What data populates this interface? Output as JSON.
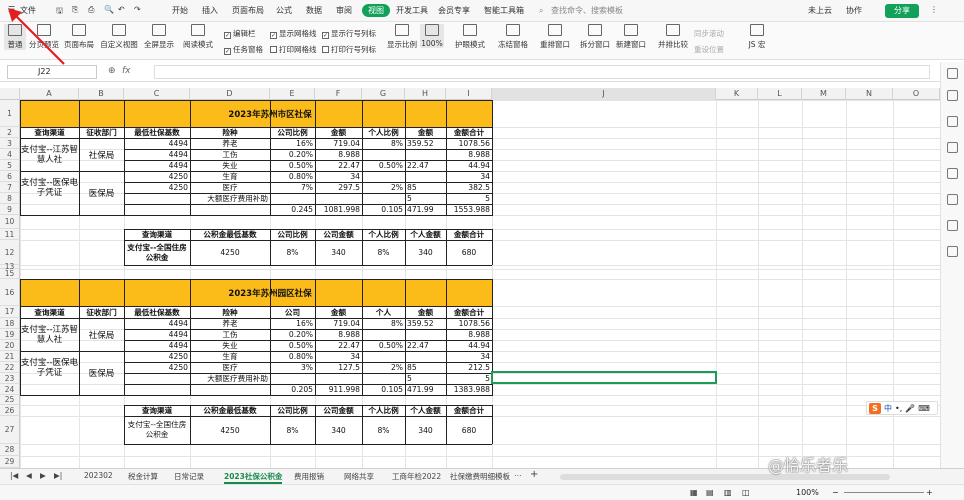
{
  "topbar": {
    "menu": "文件",
    "tabs": [
      "开始",
      "插入",
      "页面布局",
      "公式",
      "数据",
      "审阅",
      "视图",
      "开发工具",
      "会员专享",
      "智能工具箱"
    ],
    "active_tab": "视图",
    "search_placeholder": "查找命令、搜索模板",
    "cloud": "未上云",
    "collab": "协作",
    "share": "分享"
  },
  "ribbon": {
    "buttons": [
      "普通",
      "分页预览",
      "页面布局",
      "自定义视图",
      "全屏显示",
      "阅读模式",
      "显示比例",
      "100%",
      "护眼模式",
      "冻结窗格",
      "重排窗口",
      "拆分窗口",
      "新建窗口",
      "并排比较",
      "JS 宏"
    ],
    "checks": [
      {
        "label": "编辑栏",
        "checked": true
      },
      {
        "label": "显示网格线",
        "checked": true
      },
      {
        "label": "显示行号列标",
        "checked": true
      },
      {
        "label": "任务窗格",
        "checked": true
      },
      {
        "label": "打印网格线",
        "checked": false
      },
      {
        "label": "打印行号列标",
        "checked": false
      }
    ],
    "disabled": [
      "同步滚动",
      "重设位置"
    ]
  },
  "formula_bar": {
    "cell_ref": "J22",
    "fx": "fx",
    "value": ""
  },
  "columns": [
    "A",
    "B",
    "C",
    "D",
    "E",
    "F",
    "G",
    "H",
    "I",
    "J",
    "K",
    "L",
    "M",
    "N",
    "O"
  ],
  "rows": [
    "1",
    "2",
    "3",
    "4",
    "5",
    "6",
    "7",
    "8",
    "9",
    "10",
    "11",
    "12",
    "13",
    "15",
    "16",
    "17",
    "18",
    "19",
    "20",
    "21",
    "22",
    "23",
    "24",
    "25",
    "26",
    "27",
    "28",
    "29"
  ],
  "table1": {
    "title": "2023年苏州市区社保",
    "headers": [
      "查询渠道",
      "征收部门",
      "最低社保基数",
      "险种",
      "公司比例",
      "金额",
      "个人比例",
      "金额",
      "金额合计"
    ],
    "channel1": "支付宝--江苏智慧人社",
    "dept1": "社保局",
    "channel2": "支付宝--医保电子凭证",
    "dept2": "医保局",
    "rows": [
      [
        "4494",
        "养老",
        "16%",
        "719.04",
        "8%",
        "359.52",
        "1078.56"
      ],
      [
        "4494",
        "工伤",
        "0.20%",
        "8.988",
        "",
        "",
        "8.988"
      ],
      [
        "4494",
        "失业",
        "0.50%",
        "22.47",
        "0.50%",
        "22.47",
        "44.94"
      ],
      [
        "4250",
        "生育",
        "0.80%",
        "34",
        "",
        "",
        "34"
      ],
      [
        "4250",
        "医疗",
        "7%",
        "297.5",
        "2%",
        "85",
        "382.5"
      ],
      [
        "",
        "大额医疗费用补助",
        "",
        "",
        "",
        "5",
        "5"
      ],
      [
        "",
        "",
        "0.245",
        "1081.998",
        "0.105",
        "471.99",
        "1553.988"
      ]
    ],
    "fund_headers": [
      "查询渠道",
      "公积金最低基数",
      "公司比例",
      "公司金额",
      "个人比例",
      "个人金额",
      "金额合计"
    ],
    "fund_row": [
      "支付宝--全国住房公积金",
      "4250",
      "8%",
      "340",
      "8%",
      "340",
      "680"
    ]
  },
  "table2": {
    "title": "2023年苏州园区社保",
    "headers": [
      "查询渠道",
      "征收部门",
      "最低社保基数",
      "险种",
      "公司",
      "金额",
      "个人",
      "金额",
      "金额合计"
    ],
    "channel1": "支付宝--江苏智慧人社",
    "dept1": "社保局",
    "channel2": "支付宝--医保电子凭证",
    "dept2": "医保局",
    "rows": [
      [
        "4494",
        "养老",
        "16%",
        "719.04",
        "8%",
        "359.52",
        "1078.56"
      ],
      [
        "4494",
        "工伤",
        "0.20%",
        "8.988",
        "",
        "",
        "8.988"
      ],
      [
        "4494",
        "失业",
        "0.50%",
        "22.47",
        "0.50%",
        "22.47",
        "44.94"
      ],
      [
        "4250",
        "生育",
        "0.80%",
        "34",
        "",
        "",
        "34"
      ],
      [
        "4250",
        "医疗",
        "3%",
        "127.5",
        "2%",
        "85",
        "212.5"
      ],
      [
        "",
        "大额医疗费用补助",
        "",
        "",
        "",
        "5",
        "5"
      ],
      [
        "",
        "",
        "0.205",
        "911.998",
        "0.105",
        "471.99",
        "1383.988"
      ]
    ],
    "fund_headers": [
      "查询渠道",
      "公积金最低基数",
      "公司比例",
      "公司金额",
      "个人比例",
      "个人金额",
      "金额合计"
    ],
    "fund_row": [
      "支付宝--全国住房公积金",
      "4250",
      "8%",
      "340",
      "8%",
      "340",
      "680"
    ]
  },
  "sheets": [
    "202302",
    "税金计算",
    "日常记录",
    "2023社保公积金",
    "费用报销",
    "网络共享",
    "工商年检2022",
    "社保缴费明细模板"
  ],
  "active_sheet": "2023社保公积金",
  "status": {
    "zoom": "100%"
  },
  "watermark": "@恰乐者乐",
  "ime": {
    "logo": "S",
    "lang": "中"
  }
}
